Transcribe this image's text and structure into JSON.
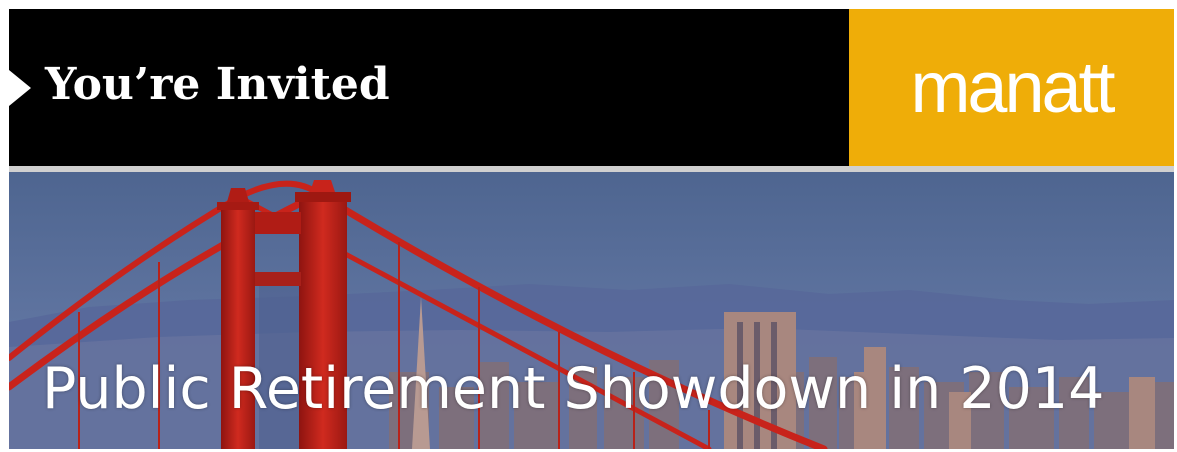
{
  "header": {
    "invite_text": "You’re Invited",
    "logo_text": "manatt"
  },
  "hero": {
    "image": "golden-gate-bridge-san-francisco-skyline",
    "title": "Public Retirement Showdown in 2014"
  },
  "colors": {
    "header_background": "#000000",
    "logo_background": "#efad08",
    "bridge_red": "#c8231b",
    "sky_blue": "#5a6f98",
    "text": "#ffffff"
  }
}
